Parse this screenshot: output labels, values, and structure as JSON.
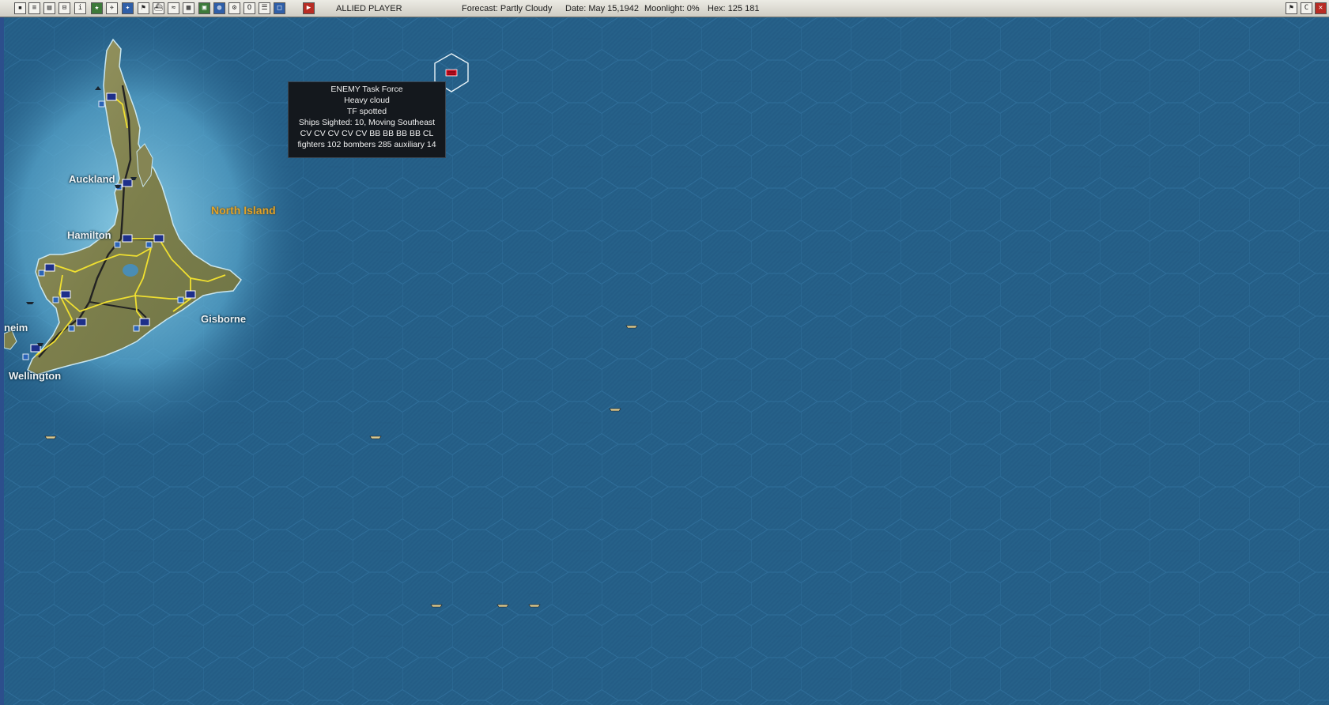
{
  "toolbar": {
    "icons": [
      "save-icon",
      "document-icon",
      "briefing-icon",
      "intel-icon",
      "info-icon",
      "star-icon",
      "aircraft-icon",
      "airgroup-icon",
      "flag-icon",
      "ship-icon",
      "wind-icon",
      "grid-icon",
      "pool-icon",
      "globe-icon",
      "replacements-icon",
      "ob-icon",
      "list-icon",
      "window-icon"
    ],
    "end_turn_icon": "play-icon",
    "player": "ALLIED PLAYER",
    "forecast": "Forecast: Partly Cloudy",
    "date": "Date: May 15,1942",
    "moonlight": "Moonlight: 0%",
    "hex": "Hex: 125 181",
    "right_icons": [
      "map-toggle-icon",
      "c-icon",
      "close-icon"
    ]
  },
  "map": {
    "ocean_color": "#245d86",
    "land_color": "#8a8a55",
    "road_color": "#f0e030",
    "rail_color": "#202020",
    "region_label": "North Island",
    "cities": [
      "Auckland",
      "Hamilton",
      "Gisborne",
      "Wellington",
      "neim"
    ],
    "enemy_marker_color": "#c8102e"
  },
  "tooltip": {
    "lines": [
      "ENEMY Task Force",
      "Heavy cloud",
      "TF spotted",
      "Ships Sighted: 10, Moving Southeast",
      "CV CV CV CV CV BB BB BB BB CL",
      "fighters 102  bombers 285  auxiliary 14"
    ]
  }
}
